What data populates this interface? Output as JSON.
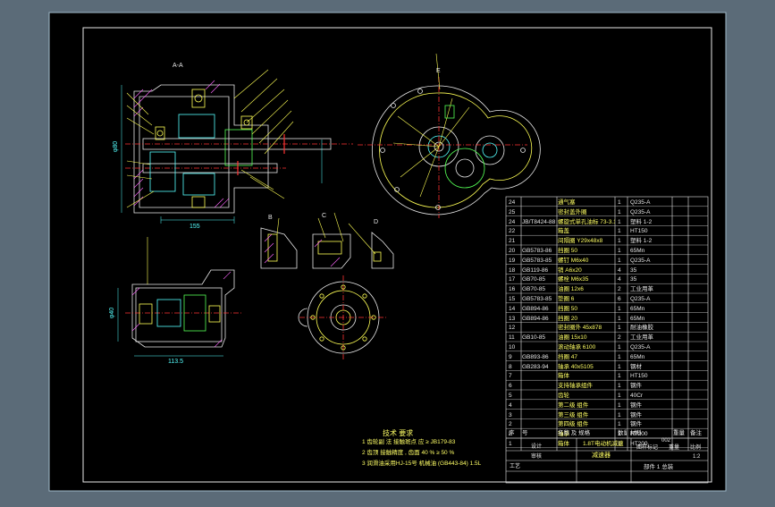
{
  "colors": {
    "outer_background": "#5b6b78",
    "sheet": "#000000",
    "border_frame": "#e8e8e8",
    "line_white": "#e8e8e8",
    "line_yellow": "#ffff55",
    "line_cyan": "#55ffff",
    "line_green": "#55ff55",
    "line_magenta": "#ff66ff",
    "line_red": "#ff3333"
  },
  "view_labels": {
    "section_aa": "A-A",
    "view_b": "B",
    "view_c": "C",
    "view_d": "D",
    "view_e": "E"
  },
  "bom_rows": [
    {
      "no": "24",
      "code": "",
      "name": "通气塞",
      "qty": "1",
      "material": "Q235-A"
    },
    {
      "no": "25",
      "code": "",
      "name": "密封盖外圈",
      "qty": "1",
      "material": "Q235-A"
    },
    {
      "no": "24",
      "code": "JB/T8424-88",
      "name": "螺旋式单孔油标 73-3.1",
      "qty": "1",
      "material": "塑料 1-2"
    },
    {
      "no": "22",
      "code": "",
      "name": "箱盖",
      "qty": "1",
      "material": "HT150"
    },
    {
      "no": "21",
      "code": "",
      "name": "间隔圈 Y29x48x8",
      "qty": "1",
      "material": "塑料 1-2"
    },
    {
      "no": "20",
      "code": "GB5783-86",
      "name": "挡圈 50",
      "qty": "1",
      "material": "65Mn"
    },
    {
      "no": "19",
      "code": "GB5783-85",
      "name": "螺钉 M6x40",
      "qty": "1",
      "material": "Q235-A"
    },
    {
      "no": "18",
      "code": "GB119-86",
      "name": "销 A6x20",
      "qty": "4",
      "material": "35"
    },
    {
      "no": "17",
      "code": "GB70-85",
      "name": "螺栓 M6x35",
      "qty": "4",
      "material": "35"
    },
    {
      "no": "16",
      "code": "GB70-85",
      "name": "油圈 12x6",
      "qty": "2",
      "material": "工业用革"
    },
    {
      "no": "15",
      "code": "GB5783-85",
      "name": "垫圈 6",
      "qty": "6",
      "material": "Q235-A"
    },
    {
      "no": "14",
      "code": "GB894-86",
      "name": "挡圈 50",
      "qty": "1",
      "material": "65Mn"
    },
    {
      "no": "13",
      "code": "GB894-86",
      "name": "挡圈 20",
      "qty": "1",
      "material": "65Mn"
    },
    {
      "no": "12",
      "code": "",
      "name": "密封圈外 45x878",
      "qty": "1",
      "material": "耐油橡胶"
    },
    {
      "no": "11",
      "code": "GB10-85",
      "name": "油圈 15x10",
      "qty": "2",
      "material": "工业用革"
    },
    {
      "no": "10",
      "code": "",
      "name": "滚动轴承 6100",
      "qty": "1",
      "material": "Q235-A"
    },
    {
      "no": "9",
      "code": "GB893-86",
      "name": "挡圈 47",
      "qty": "1",
      "material": "65Mn"
    },
    {
      "no": "8",
      "code": "GB283-94",
      "name": "轴承 40x5105",
      "qty": "1",
      "material": "钢材"
    },
    {
      "no": "7",
      "code": "",
      "name": "箱体",
      "qty": "1",
      "material": "HT150"
    },
    {
      "no": "6",
      "code": "",
      "name": "支持轴承组件",
      "qty": "1",
      "material": "钢件"
    },
    {
      "no": "5",
      "code": "",
      "name": "齿轮",
      "qty": "1",
      "material": "40Cr"
    },
    {
      "no": "4",
      "code": "",
      "name": "第二级 组件",
      "qty": "1",
      "material": "钢件"
    },
    {
      "no": "3",
      "code": "",
      "name": "第三级 组件",
      "qty": "1",
      "material": "钢件"
    },
    {
      "no": "2",
      "code": "",
      "name": "第四级 组件",
      "qty": "1",
      "material": "钢件"
    },
    {
      "no": "2",
      "code": "",
      "name": "轴承",
      "qty": "1",
      "material": "HT200"
    },
    {
      "no": "1",
      "code": "",
      "name": "箱体",
      "qty": "1",
      "material": "HT200"
    }
  ],
  "bom_header": {
    "no": "序",
    "code": "号",
    "name": "名称 及 规格",
    "qty": "数量",
    "material": "材料",
    "weight": "重量",
    "remark": "备注"
  },
  "title_block": {
    "product": "1.8T电动机减速",
    "drawing_name": "减速器",
    "design": "设计",
    "check": "审核",
    "process": "工艺",
    "scale_label": "图样标记",
    "weight_label": "重量",
    "ratio_label": "比例",
    "ratio": "1:2",
    "sheet_info": "部件 1 总装",
    "code": "002"
  },
  "tech_requirements": {
    "title": "技术 要求",
    "items": [
      "1  齿轮副 法 接触斑点  应  ≥   JB179-83",
      "2  齿顶 接触精度 , 齿面 40 %  ≥   50 %",
      "3  润滑油采用HJ-15号 机械油 (GB443-84) 1.5L"
    ]
  },
  "dimension_labels": {
    "d1": "φ80",
    "d2": "155",
    "d3": "φ40",
    "d4": "113.5"
  }
}
